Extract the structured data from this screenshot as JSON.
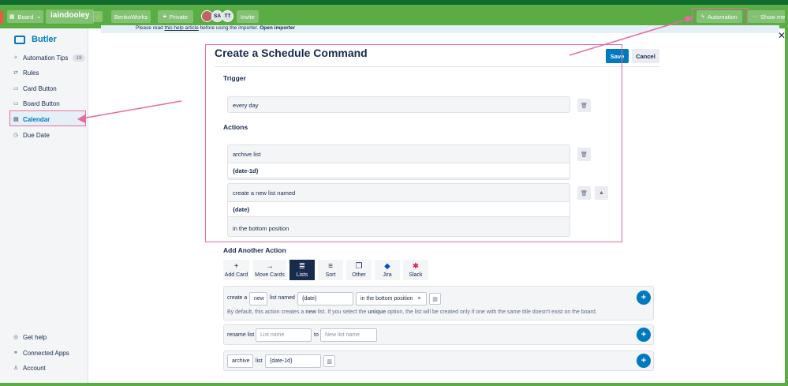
{
  "header": {
    "board_menu": "Board",
    "board_title": "iaindooley",
    "team": "BenkoWorks",
    "visibility": "Private",
    "members": [
      "SA",
      "TT"
    ],
    "invite": "Invite",
    "automation": "Automation",
    "show_menu": "Show menu"
  },
  "sidebar": {
    "brand": "Butler",
    "items": [
      {
        "label": "Automation Tips",
        "count": "19"
      },
      {
        "label": "Rules"
      },
      {
        "label": "Card Button"
      },
      {
        "label": "Board Button"
      },
      {
        "label": "Calendar"
      },
      {
        "label": "Due Date"
      }
    ],
    "bottom_items": [
      {
        "label": "Get help"
      },
      {
        "label": "Connected Apps"
      },
      {
        "label": "Account"
      }
    ]
  },
  "banner": {
    "text_prefix": "Please read",
    "link": "this help article",
    "text_suffix": "before using the importer.",
    "importer_link": "Open importer"
  },
  "modal": {
    "title": "Create a Schedule Command",
    "save": "Save",
    "cancel": "Cancel",
    "trigger_heading": "Trigger",
    "trigger_value": "every day",
    "actions_heading": "Actions",
    "action1": {
      "text": "archive list",
      "param": "{date-1d}"
    },
    "action2": {
      "text": "create a new list named",
      "param": "{date}",
      "suffix": "in the bottom position"
    }
  },
  "add_action": {
    "heading": "Add Another Action",
    "tabs": [
      {
        "label": "Add Card",
        "icon": "+"
      },
      {
        "label": "Move Cards",
        "icon": "→"
      },
      {
        "label": "Lists",
        "icon": "≣"
      },
      {
        "label": "Sort",
        "icon": "≡"
      },
      {
        "label": "Other",
        "icon": "❐"
      },
      {
        "label": "Jira",
        "icon": "◆"
      },
      {
        "label": "Slack",
        "icon": "✱"
      }
    ]
  },
  "cmd1": {
    "create_a": "create a",
    "new": "new",
    "list_named": "list named",
    "name_value": "{date}",
    "position": "in the bottom position",
    "remove": "×",
    "hint_pre": "By default, this action creates a",
    "hint_new": "new",
    "hint_mid": "list. If you select the",
    "hint_unique": "unique",
    "hint_post": "option, the list will be created only if one with the same title doesn't exist on the board."
  },
  "cmd2": {
    "rename_list": "rename list",
    "list_name_ph": "List name",
    "to": "to",
    "new_list_name_ph": "New list name"
  },
  "cmd3": {
    "archive": "archive",
    "list": "list",
    "value": "{date-1d}"
  },
  "colors": {
    "header_green": "#5aac44",
    "accent_blue": "#0079bf",
    "annotation_pink": "#e86aa1"
  }
}
